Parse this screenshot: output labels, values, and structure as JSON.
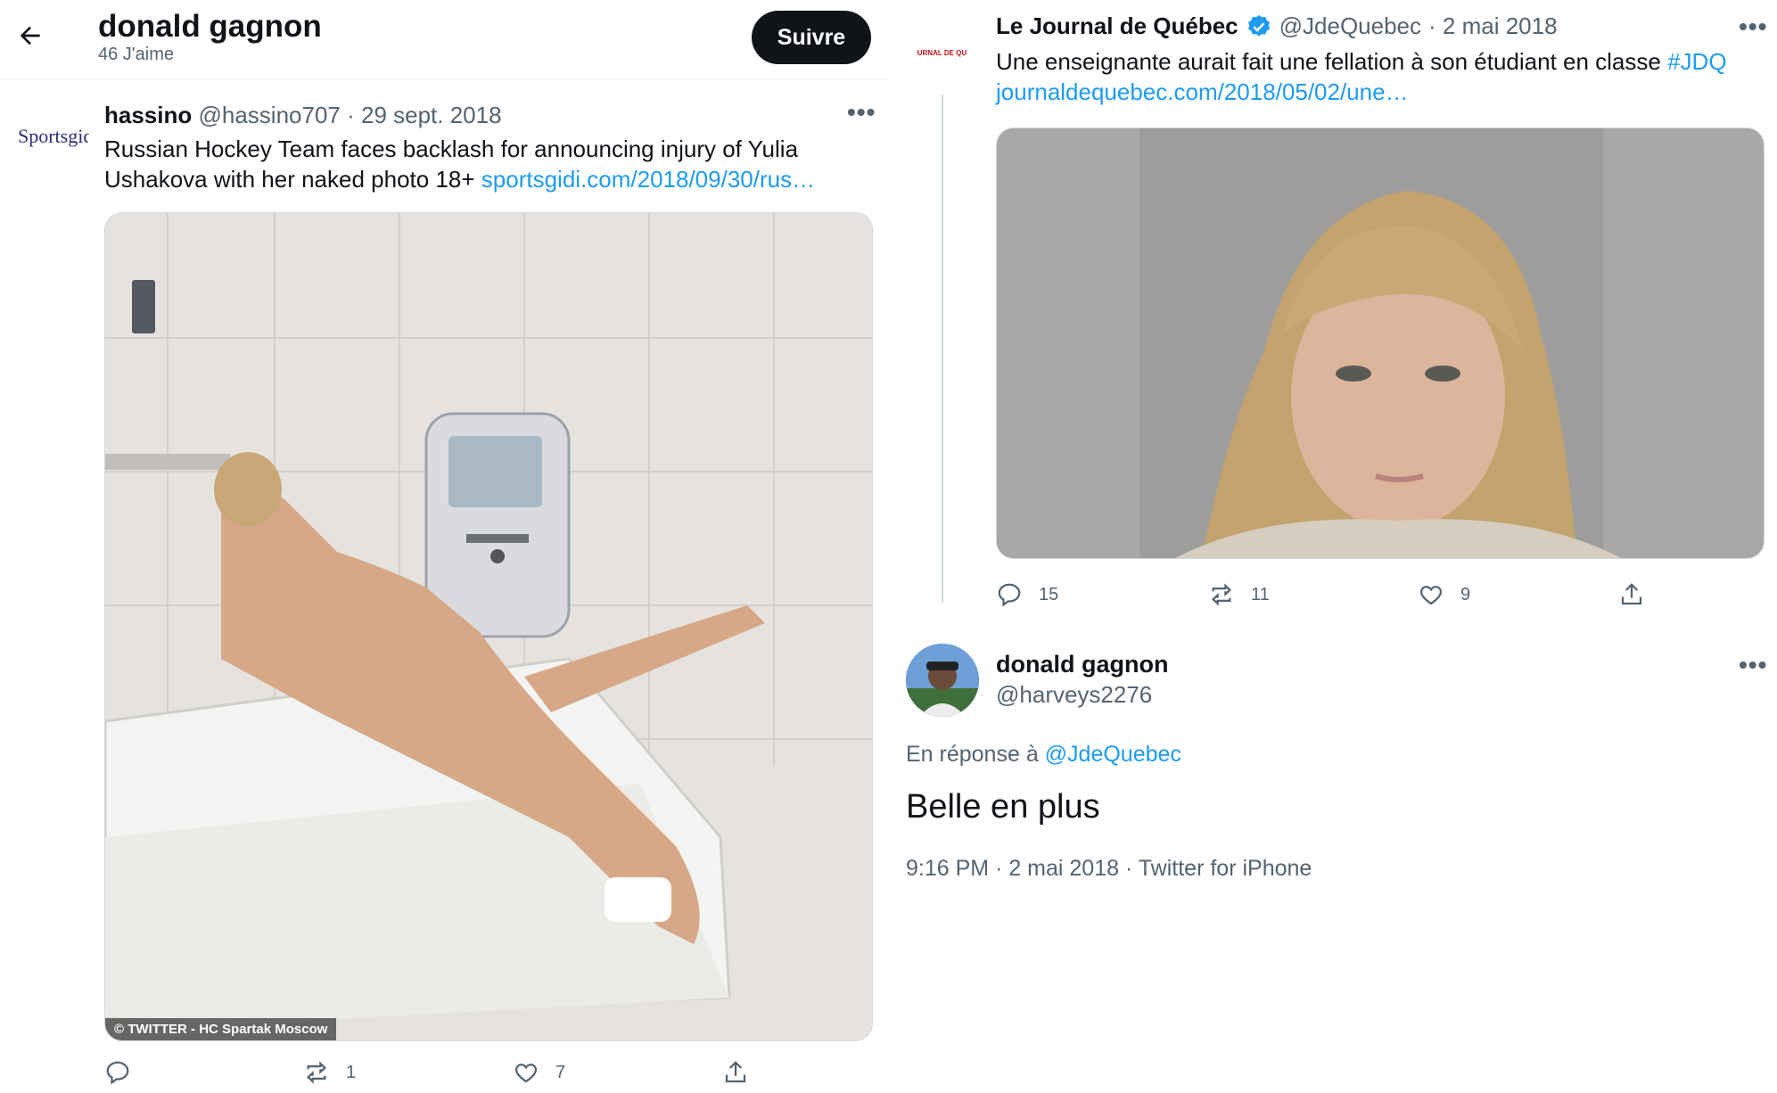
{
  "header": {
    "title": "donald gagnon",
    "subtitle": "46 J'aime",
    "follow_label": "Suivre"
  },
  "left_tweet": {
    "author_name": "hassino",
    "author_handle": "@hassino707",
    "date": "· 29 sept. 2018",
    "text_prefix": "Russian Hockey Team faces backlash for announcing injury of Yulia Ushakova with her naked photo 18+ ",
    "link": "sportsgidi.com/2018/09/30/rus…",
    "avatar_text": "Sportsgidi",
    "image_credit": "© TWITTER - HC Spartak Moscow",
    "actions": {
      "reply_count": "",
      "retweet_count": "1",
      "like_count": "7"
    }
  },
  "right_tweet": {
    "author_name": "Le Journal de Québec",
    "author_handle": "@JdeQuebec",
    "date": "· 2 mai 2018",
    "text_prefix": "Une enseignante aurait fait une fellation à son étudiant en classe ",
    "hashtag": "#JDQ",
    "link": "journaldequebec.com/2018/05/02/une…",
    "logo_text": "LE JOURNAL DE QUÉBEC",
    "actions": {
      "reply_count": "15",
      "retweet_count": "11",
      "like_count": "9"
    }
  },
  "reply": {
    "author_name": "donald gagnon",
    "author_handle": "@harveys2276",
    "reply_to_prefix": "En réponse à ",
    "reply_to_handle": "@JdeQuebec",
    "text": "Belle en plus",
    "meta": "9:16 PM · 2 mai 2018 · Twitter for iPhone"
  },
  "colors": {
    "accent": "#1d9bf0",
    "text": "#0f1419",
    "muted": "#536471",
    "follow_bg": "#0f1419"
  }
}
